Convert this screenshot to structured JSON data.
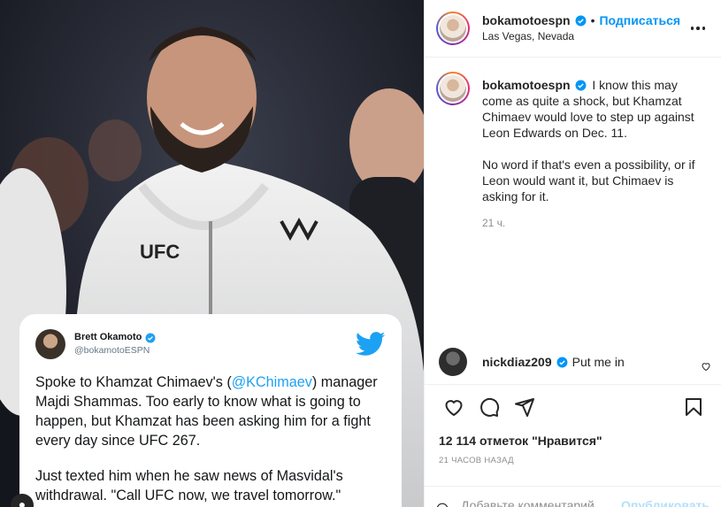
{
  "tweet": {
    "author_name": "Brett Okamoto",
    "author_handle": "@bokamotoESPN",
    "body_part1": "Spoke to Khamzat Chimaev's (",
    "body_mention": "@KChimaev",
    "body_part2": ") manager Majdi Shammas. Too early to know what is going to happen, but Khamzat has been asking him for a fight every day since UFC 267.",
    "body_para2": "Just texted him when he saw news of Masvidal's withdrawal. \"Call UFC now, we travel tomorrow.\""
  },
  "header": {
    "username": "bokamotoespn",
    "separator": "•",
    "follow_label": "Подписаться",
    "location": "Las Vegas, Nevada"
  },
  "caption": {
    "username": "bokamotoespn",
    "para1": "I know this may come as quite a shock, but Khamzat Chimaev would love to step up against Leon Edwards on Dec. 11.",
    "para2": "No word if that's even a possibility, or if Leon would want it, but Chimaev is asking for it.",
    "time": "21 ч."
  },
  "comment": {
    "username": "nickdiaz209",
    "text": "Put me in"
  },
  "likes_text": "12 114 отметок \"Нравится\"",
  "post_date": "21 ЧАСОВ НАЗАД",
  "comment_box": {
    "placeholder": "Добавьте комментарий...",
    "publish_label": "Опубликовать"
  },
  "colors": {
    "accent": "#0095f6",
    "twitter_blue": "#1da1f2",
    "publish_disabled": "#b2dffc"
  },
  "icons": [
    "verified-icon",
    "more-options-icon",
    "like-icon",
    "comment-icon",
    "share-icon",
    "save-icon",
    "emoji-icon",
    "twitter-icon",
    "heart-small-icon",
    "tag-user-icon"
  ]
}
